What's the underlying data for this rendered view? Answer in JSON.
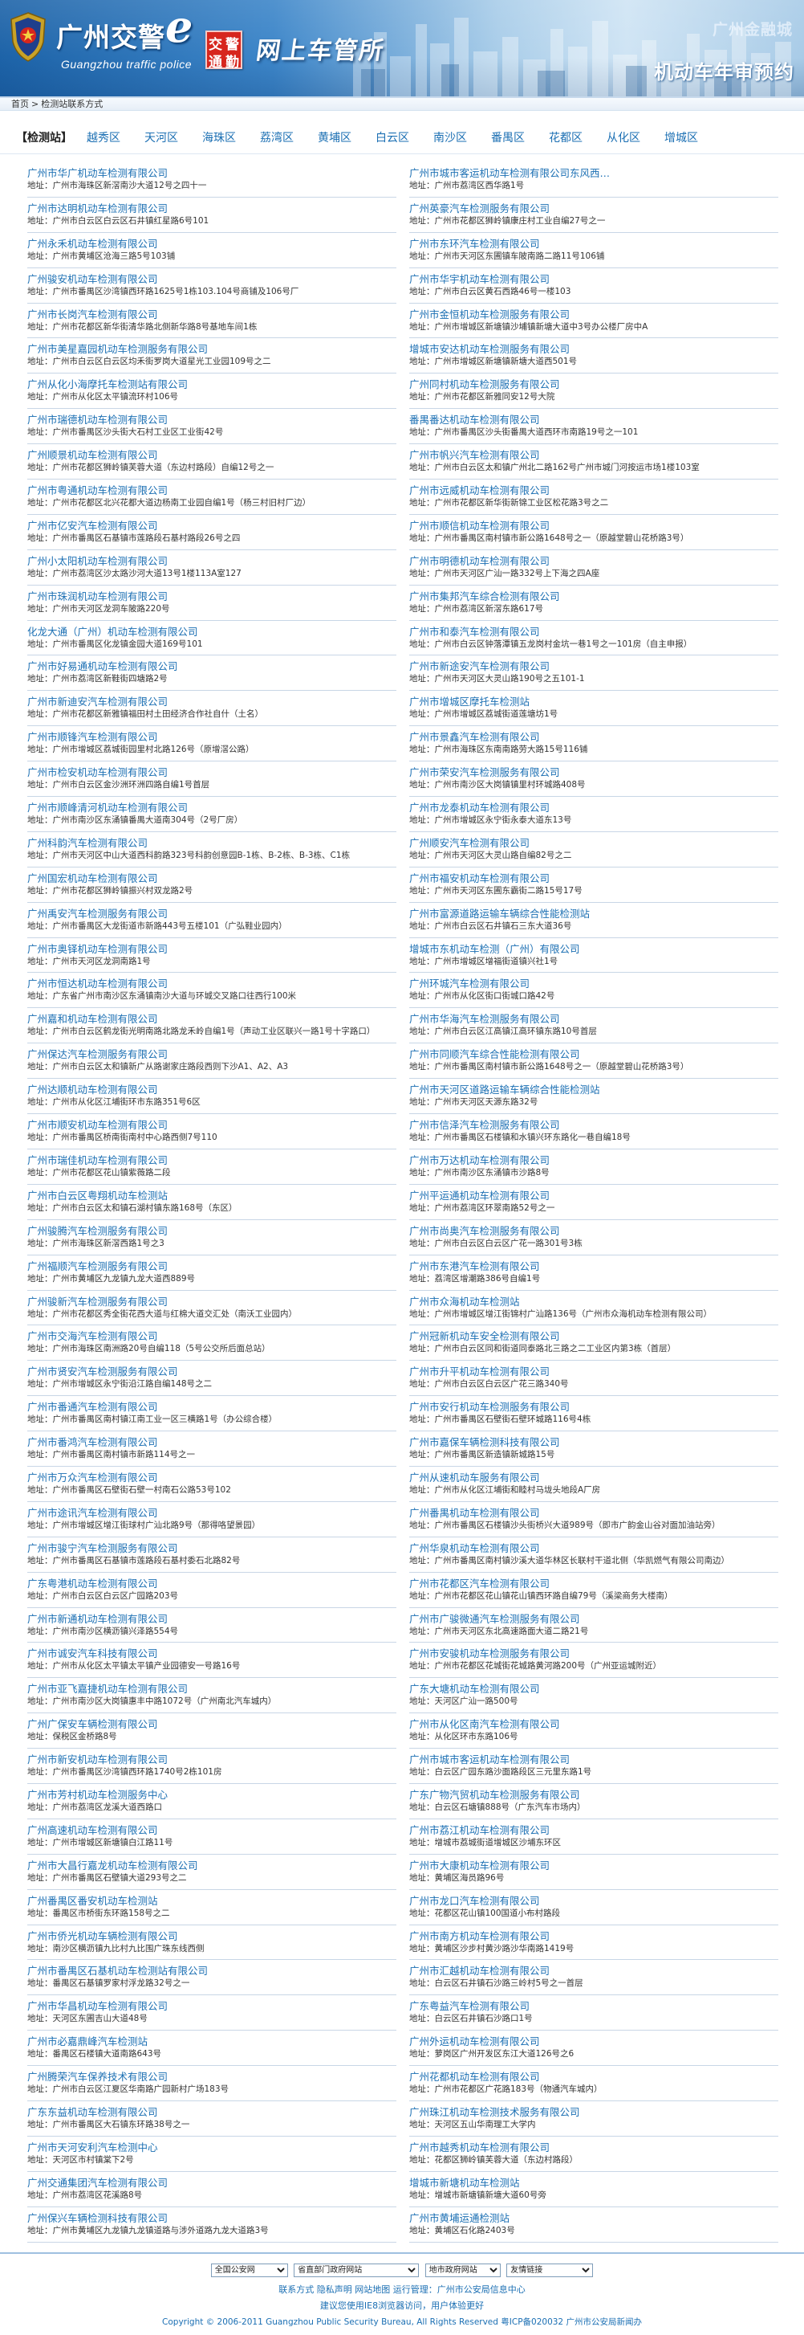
{
  "header": {
    "logo_cn": "广州交警",
    "logo_e": "e",
    "logo_en": "Guangzhou traffic police",
    "seal_chars": [
      "交",
      "警",
      "通",
      "勤"
    ],
    "hand_title": "网上车管所",
    "city_name": "广州金融城",
    "page_heading": "机动车年审预约"
  },
  "breadcrumb": {
    "home": "首页",
    "sep": ">",
    "current": "检测站联系方式"
  },
  "districts": {
    "current": "【检测站】",
    "items": [
      "越秀区",
      "天河区",
      "海珠区",
      "荔湾区",
      "黄埔区",
      "白云区",
      "南沙区",
      "番禺区",
      "花都区",
      "从化区",
      "增城区"
    ]
  },
  "stations": {
    "left": [
      {
        "name": "广州市华广机动车检测有限公司",
        "addr": "地址：广州市海珠区新滘南沙大道12号之四十一"
      },
      {
        "name": "广州市达明机动车检测有限公司",
        "addr": "地址：广州市白云区白云区石井镇红星路6号101"
      },
      {
        "name": "广州永禾机动车检测有限公司",
        "addr": "地址：广州市黄埔区沧海三路5号103铺"
      },
      {
        "name": "广州骏安机动车检测有限公司",
        "addr": "地址：广州市番禺区沙湾镇西环路1625号1栋103.104号商铺及106号厂"
      },
      {
        "name": "广州市长岗汽车检测有限公司",
        "addr": "地址：广州市花都区新华街清华路北侧新华路8号基地车间1栋"
      },
      {
        "name": "广州市美星嘉园机动车检测服务有限公司",
        "addr": "地址：广州市白云区白云区均禾街罗岗大道星光工业园109号之二"
      },
      {
        "name": "广州从化小海摩托车检测站有限公司",
        "addr": "地址：广州市从化区太平镇流环村106号"
      },
      {
        "name": "广州市瑞德机动车检测有限公司",
        "addr": "地址：广州市番禺区沙头街大石村工业区工业街42号"
      },
      {
        "name": "广州顺景机动车检测有限公司",
        "addr": "地址：广州市花都区狮岭镇芙蓉大道（东边村路段）自编12号之一"
      },
      {
        "name": "广州市粤通机动车检测有限公司",
        "addr": "地址：广州市花都区北兴花都大道边杨南工业园自编1号（杨三村旧村厂边）"
      },
      {
        "name": "广州市亿安汽车检测有限公司",
        "addr": "地址：广州市番禺区石基镇市莲路段石基村路段26号之四"
      },
      {
        "name": "广州小太阳机动车检测有限公司",
        "addr": "地址：广州市荔湾区沙太路沙河大道13号1楼113A室127"
      },
      {
        "name": "广州市珠润机动车检测有限公司",
        "addr": "地址：广州市天河区龙洞车陂路220号"
      },
      {
        "name": "化龙大通（广州）机动车检测有限公司",
        "addr": "地址：广州市番禺区化龙镇金园大道169号101"
      },
      {
        "name": "广州市好易通机动车检测有限公司",
        "addr": "地址：广州市荔湾区新鞋街四塘路2号"
      },
      {
        "name": "广州市新迪安汽车检测有限公司",
        "addr": "地址：广州市花都区新雅镇福田村土田经济合作社自什（土名）"
      },
      {
        "name": "广州市顺锋汽车检测有限公司",
        "addr": "地址：广州市增城区荔城街园里村北路126号（原增滘公路）"
      },
      {
        "name": "广州市检安机动车检测有限公司",
        "addr": "地址：广州市白云区金沙洲环洲四路自编1号首层"
      },
      {
        "name": "广州市顺峰清河机动车检测有限公司",
        "addr": "地址：广州市南沙区东涌镇番禺大道南304号（2号厂房）"
      },
      {
        "name": "广州科韵汽车检测有限公司",
        "addr": "地址：广州市天河区中山大道西科韵路323号科韵创意园B-1栋、B-2栋、B-3栋、C1栋"
      },
      {
        "name": "广州国宏机动车检测有限公司",
        "addr": "地址：广州市花都区狮岭镇振兴村双龙路2号"
      },
      {
        "name": "广州禹安汽车检测服务有限公司",
        "addr": "地址：广州市番禺区大龙街道市新路443号五楼101（广弘鞋业园内）"
      },
      {
        "name": "广州市奥铎机动车检测有限公司",
        "addr": "地址：广州市天河区龙洞南路1号"
      },
      {
        "name": "广州市恒达机动车检测有限公司",
        "addr": "地址：广东省广州市南沙区东涌镇南沙大道与环城交叉路口往西行100米"
      },
      {
        "name": "广州嘉和机动车检测有限公司",
        "addr": "地址：广州市白云区鹤龙街光明南路北路龙禾岭自编1号（声动工业区联兴一路1号十字路口）"
      },
      {
        "name": "广州保达汽车检测服务有限公司",
        "addr": "地址：广州市白云区太和镇新广从路谢家庄路段西则下沙A1、A2、A3"
      },
      {
        "name": "广州达顺机动车检测有限公司",
        "addr": "地址：广州市从化区江埔街环市东路351号6区"
      },
      {
        "name": "广州市顺安机动车检测有限公司",
        "addr": "地址：广州市番禺区桥南街南村中心路西侧7号110"
      },
      {
        "name": "广州市瑞佳机动车检测有限公司",
        "addr": "地址：广州市花都区花山镇紫薇路二段"
      },
      {
        "name": "广州市白云区粤翔机动车检测站",
        "addr": "地址：广州市白云区太和镇石湖村镇东路168号（东区）"
      },
      {
        "name": "广州骏腾汽车检测服务有限公司",
        "addr": "地址：广州市海珠区新滘西路1号之3"
      },
      {
        "name": "广州福顺汽车检测服务有限公司",
        "addr": "地址：广州市黄埔区九龙镇九龙大道西889号"
      },
      {
        "name": "广州骏新汽车检测服务有限公司",
        "addr": "地址：广州市花都区秀全街花西大道与红棉大道交汇处（南沃工业园内）"
      },
      {
        "name": "广州市交海汽车检测有限公司",
        "addr": "地址：广州市海珠区南洲路20号自编118（5号公交所后面总站）"
      },
      {
        "name": "广州市贤安汽车检测服务有限公司",
        "addr": "地址：广州市增城区永宁街沿江路自编148号之二"
      },
      {
        "name": "广州市番通汽车检测有限公司",
        "addr": "地址：广州市番禺区南村镇江南工业一区三横路1号（办公综合楼）"
      },
      {
        "name": "广州市番鸿汽车检测有限公司",
        "addr": "地址：广州市番禺区南村镇市新路114号之一"
      },
      {
        "name": "广州市万众汽车检测有限公司",
        "addr": "地址：广州市番禺区石壁街石壁一村南石公路53号102"
      },
      {
        "name": "广州市途讯汽车检测有限公司",
        "addr": "地址：广州市增城区增江街球村广汕北路9号（那得咯望景园）"
      },
      {
        "name": "广州市骏宁汽车检测服务有限公司",
        "addr": "地址：广州市番禺区石基镇市莲路段石基村委石北路82号"
      },
      {
        "name": "广东粤港机动车检测有限公司",
        "addr": "地址：广州市白云区白云区广园路203号"
      },
      {
        "name": "广州市新通机动车检测有限公司",
        "addr": "地址：广州市南沙区横沥镇兴泽路554号"
      },
      {
        "name": "广州市诚安汽车科技有限公司",
        "addr": "地址：广州市从化区太平镇太平镇产业园德安一号路16号"
      },
      {
        "name": "广州市亚飞嘉捷机动车检测有限公司",
        "addr": "地址：广州市南沙区大岗镇惠丰中路1072号（广州南北汽车城内）"
      },
      {
        "name": "广州广保安车辆检测有限公司",
        "addr": "地址：保税区金桥路8号"
      },
      {
        "name": "广州市新安机动车检测有限公司",
        "addr": "地址：广州市番禺区沙湾镇西环路1740号2栋101房"
      },
      {
        "name": "广州市芳村机动车检测服务中心",
        "addr": "地址：广州市荔湾区龙溪大道西路口"
      },
      {
        "name": "广州高速机动车检测有限公司",
        "addr": "地址：广州市增城区新塘镇白江路11号"
      },
      {
        "name": "广州市大昌行嘉龙机动车检测有限公司",
        "addr": "地址：广州市番禺区石壁镇大道293号之二"
      },
      {
        "name": "广州番禺区番安机动车检测站",
        "addr": "地址：番禺区市桥街东环路158号之二"
      },
      {
        "name": "广州市侨光机动车辆检测有限公司",
        "addr": "地址：南沙区横沥镇九比村九比围广珠东线西侧"
      },
      {
        "name": "广州市番禺区石基机动车检测站有限公司",
        "addr": "地址：番禺区石基镇罗家村浮龙路32号之一"
      },
      {
        "name": "广州市华昌机动车检测有限公司",
        "addr": "地址：天河区东圃吉山大道48号"
      },
      {
        "name": "广州市必嘉鼎峰汽车检测站",
        "addr": "地址：番禺区石楼镇大道南路643号"
      },
      {
        "name": "广州腾荣汽车保养技术有限公司",
        "addr": "地址：广州市白云区江夏区华南路广园新村广场183号"
      },
      {
        "name": "广东东益机动车检测有限公司",
        "addr": "地址：广州市番禺区大石镇东环路38号之一"
      },
      {
        "name": "广州市天河安利汽车检测中心",
        "addr": "地址：天河区市村镇棠下2号"
      },
      {
        "name": "广州交通集团汽车检测有限公司",
        "addr": "地址：广州市荔湾区花溪路8号"
      },
      {
        "name": "广州保兴车辆检测科技有限公司",
        "addr": "地址：广州市黄埔区九龙镇九龙镇道路与涉外道路九龙大道路3号"
      }
    ],
    "right": [
      {
        "name": "广州市城市客运机动车检测有限公司东风西…",
        "addr": "地址：广州市荔湾区西华路1号"
      },
      {
        "name": "广州英豪汽车检测服务有限公司",
        "addr": "地址：广州市花都区狮岭镇康庄村工业自编27号之一"
      },
      {
        "name": "广州市东环汽车检测有限公司",
        "addr": "地址：广州市天河区东圃镇车陂南路二路11号106铺"
      },
      {
        "name": "广州市华宇机动车检测有限公司",
        "addr": "地址：广州市白云区黄石西路46号一楼103"
      },
      {
        "name": "广州市金恒机动车检测服务有限公司",
        "addr": "地址：广州市增城区新塘镇沙埔镇新塘大道中3号办公楼厂房中A"
      },
      {
        "name": "增城市安达机动车检测服务有限公司",
        "addr": "地址：广州市增城区新塘镇新塘大道西501号"
      },
      {
        "name": "广州同村机动车检测服务有限公司",
        "addr": "地址：广州市花都区新雅同安12号大院"
      },
      {
        "name": "番禺番达机动车检测有限公司",
        "addr": "地址：广州市番禺区沙头街番禺大道西环市南路19号之一101"
      },
      {
        "name": "广州市帆兴汽车检测有限公司",
        "addr": "地址：广州市白云区太和镇广州北二路162号广州市城门河按运市场1楼103室"
      },
      {
        "name": "广州市远威机动车检测有限公司",
        "addr": "地址：广州市花都区新华街新锦工业区松花路3号之二"
      },
      {
        "name": "广州市顺信机动车检测有限公司",
        "addr": "地址：广州市番禺区南村镇市新公路1648号之一（原越堂碧山花桥路3号）"
      },
      {
        "name": "广州市明德机动车检测有限公司",
        "addr": "地址：广州市天河区广汕一路332号上下海之四A座"
      },
      {
        "name": "广州市集邦汽车综合检测有限公司",
        "addr": "地址：广州市荔湾区新滘东路617号"
      },
      {
        "name": "广州市和泰汽车检测有限公司",
        "addr": "地址：广州市白云区钟落潭镇五龙岗村金坑一巷1号之一101房（自主申报）"
      },
      {
        "name": "广州市新途安汽车检测有限公司",
        "addr": "地址：广州市天河区大灵山路190号之五101-1"
      },
      {
        "name": "广州市增城区摩托车检测站",
        "addr": "地址：广州市增城区荔城街道莲塘坊1号"
      },
      {
        "name": "广州市景鑫汽车检测有限公司",
        "addr": "地址：广州市海珠区东南南路劳大路15号116铺"
      },
      {
        "name": "广州市荣安汽车检测服务有限公司",
        "addr": "地址：广州市南沙区大岗镇镇里村环城路408号"
      },
      {
        "name": "广州市龙泰机动车检测有限公司",
        "addr": "地址：广州市增城区永宁街永泰大道东13号"
      },
      {
        "name": "广州顺安汽车检测有限公司",
        "addr": "地址：广州市天河区大灵山路自编82号之二"
      },
      {
        "name": "广州市福安机动车检测有限公司",
        "addr": "地址：广州市天河区东圃东霸街二路15号17号"
      },
      {
        "name": "广州市富源道路运输车辆综合性能检测站",
        "addr": "地址：广州市白云区石井镇石三东大道36号"
      },
      {
        "name": "增城市东机动车检测（广州）有限公司",
        "addr": "地址：广州市增城区增福街道镇兴社1号"
      },
      {
        "name": "广州环城汽车检测有限公司",
        "addr": "地址：广州市从化区街口街城口路42号"
      },
      {
        "name": "广州市华海汽车检测服务有限公司",
        "addr": "地址：广州市白云区江高镇江高环镇东路10号首层"
      },
      {
        "name": "广州市同顺汽车综合性能检测有限公司",
        "addr": "地址：广州市番禺区南村镇市新公路1648号之一（原越堂碧山花桥路3号）"
      },
      {
        "name": "广州市天河区道路运输车辆综合性能检测站",
        "addr": "地址：广州市天河区天源东路32号"
      },
      {
        "name": "广州市信泽汽车检测服务有限公司",
        "addr": "地址：广州市番禺区石楼镇和水镇兴环东路化一巷自编18号"
      },
      {
        "name": "广州市万达机动车检测有限公司",
        "addr": "地址：广州市南沙区东涌镇市沙路8号"
      },
      {
        "name": "广州平运通机动车检测有限公司",
        "addr": "地址：广州市荔湾区环翠南路52号之一"
      },
      {
        "name": "广州市尚奥汽车检测服务有限公司",
        "addr": "地址：广州市白云区白云区广花一路301号3栋"
      },
      {
        "name": "广州市东港汽车检测有限公司",
        "addr": "地址：荔湾区增潮路386号自编1号"
      },
      {
        "name": "广州市众海机动车检测站",
        "addr": "地址：广州市增城区增江街锦村广汕路136号（广州市众海机动车检测有限公司）"
      },
      {
        "name": "广州冠新机动车安全检测有限公司",
        "addr": "地址：广州市白云区同和街道同泰路北三路之二工业区内第3栋（首层）"
      },
      {
        "name": "广州市升平机动车检测有限公司",
        "addr": "地址：广州市白云区白云区广花三路340号"
      },
      {
        "name": "广州市安行机动车检测服务有限公司",
        "addr": "地址：广州市番禺区石壁街石壁环城路116号4栋"
      },
      {
        "name": "广州市嘉保车辆检测科技有限公司",
        "addr": "地址：广州市番禺区新造镇新城路15号"
      },
      {
        "name": "广州从速机动车服务有限公司",
        "addr": "地址：广州市从化区江埔街和睦村马垅头地段A厂房"
      },
      {
        "name": "广州番禺机动车检测有限公司",
        "addr": "地址：广州市番禺区石楼镇沙头街桥兴大道989号（即市广韵金山谷对面加油站旁）"
      },
      {
        "name": "广州华泉机动车检测有限公司",
        "addr": "地址：广州市番禺区南村镇沙溪大道华林区长联村干道北侧（华凯燃气有限公司南边）"
      },
      {
        "name": "广州市花都区汽车检测有限公司",
        "addr": "地址：广州市花都区花山镇花山镇西环路自编79号（溪梁商务大楼南）"
      },
      {
        "name": "广州市广骏微通汽车检测服务有限公司",
        "addr": "地址：广州市天河区东北高速路面大道二路21号"
      },
      {
        "name": "广州市安骏机动车检测服务有限公司",
        "addr": "地址：广州市花都区花城街花城路黄河路200号（广州亚运城附近）"
      },
      {
        "name": "广东大塘机动车检测有限公司",
        "addr": "地址：天河区广汕一路500号"
      },
      {
        "name": "广州市从化区南汽车检测有限公司",
        "addr": "地址：从化区环市东路106号"
      },
      {
        "name": "广州市城市客运机动车检测有限公司",
        "addr": "地址：白云区广园东路沙面路段区三元里东路1号"
      },
      {
        "name": "广东广物汽贸机动车检测服务有限公司",
        "addr": "地址：白云区石塘镇888号（广东汽车市场内）"
      },
      {
        "name": "广州市荔江机动车检测有限公司",
        "addr": "地址：增城市荔城街道增城区沙埔东环区"
      },
      {
        "name": "广州市大康机动车检测有限公司",
        "addr": "地址：黄埔区海员路96号"
      },
      {
        "name": "广州市龙口汽车检测有限公司",
        "addr": "地址：花都区花山镇100国道小布村路段"
      },
      {
        "name": "广州市南方机动车检测有限公司",
        "addr": "地址：黄埔区沙步村黄沙路沙华南路1419号"
      },
      {
        "name": "广州市汇越机动车检测有限公司",
        "addr": "地址：白云区石井镇石沙路三岭村5号之一首层"
      },
      {
        "name": "广东粤益汽车检测有限公司",
        "addr": "地址：白云区石井镇石沙路口1号"
      },
      {
        "name": "广州外运机动车检测有限公司",
        "addr": "地址：萝岗区广州开发区东江大道126号之6"
      },
      {
        "name": "广州花都机动车检测有限公司",
        "addr": "地址：广州市花都区广花路183号（物通汽车城内）"
      },
      {
        "name": "广州珠江机动车检测技术服务有限公司",
        "addr": "地址：天河区五山华南理工大学内"
      },
      {
        "name": "广州市越秀机动车检测有限公司",
        "addr": "地址：花都区狮岭镇芙蓉大道（东边村路段）"
      },
      {
        "name": "增城市新塘机动车检测站",
        "addr": "地址：增城市新塘镇新塘大道60号旁"
      },
      {
        "name": "广州市黄埔运通检测站",
        "addr": "地址：黄埔区石化路2403号"
      }
    ]
  },
  "footer": {
    "selects": [
      "全国公安网",
      "省直部门政府网站",
      "地市政府网站",
      "友情链接"
    ],
    "links_line": "联系方式 隐私声明 网站地图  运行管理：广州市公安局信息中心",
    "hint_line": "建议您使用IE8浏览器访问，用户体验更好",
    "copyright": "Copyright © 2006-2011 Guangzhou Public Security Bureau, All Rights Reserved 粤ICP备020032 广州市公安局新闻办"
  }
}
